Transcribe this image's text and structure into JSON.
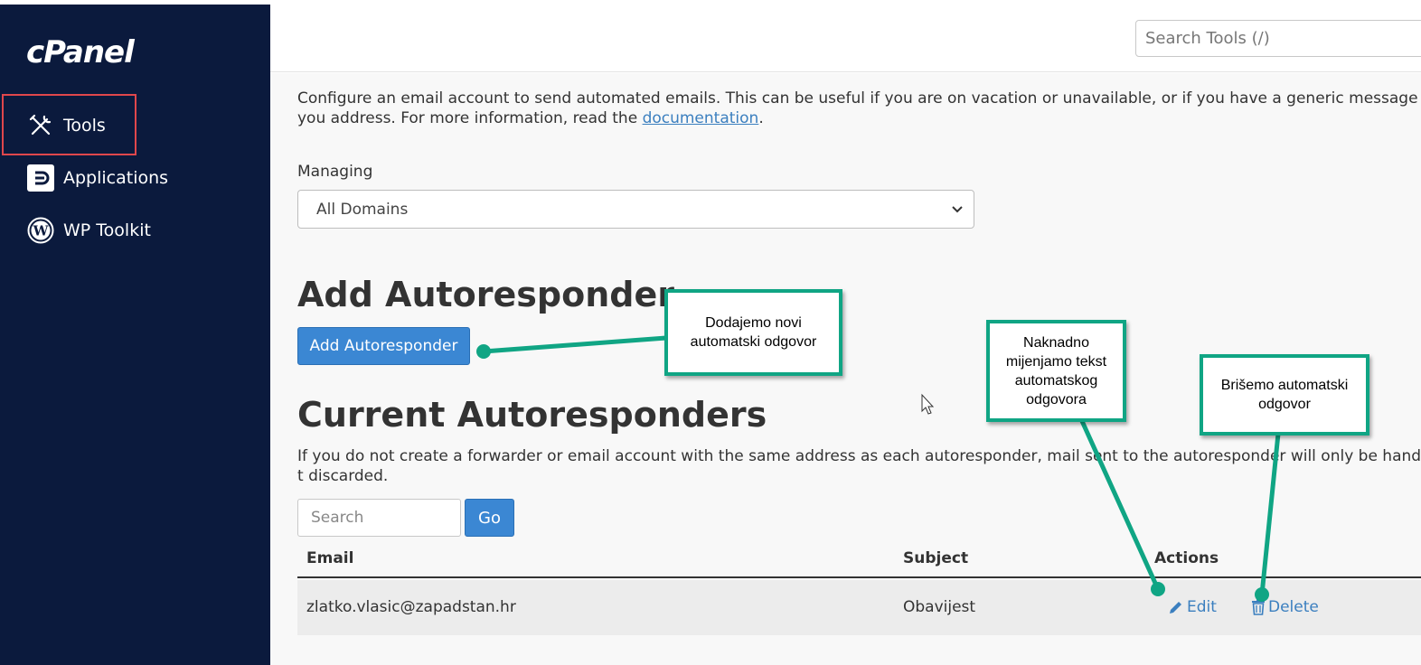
{
  "sidebar": {
    "logo": "cPanel",
    "items": [
      {
        "label": "Tools",
        "icon": "tools-icon"
      },
      {
        "label": "Applications",
        "icon": "applications-icon"
      },
      {
        "label": "WP Toolkit",
        "icon": "wordpress-icon"
      }
    ]
  },
  "header": {
    "search_placeholder": "Search Tools (/)"
  },
  "intro": {
    "text_before": "Configure an email account to send automated emails. This can be useful if you are on vacation or unavailable, or if you have a generic message that you address. For more information, read the ",
    "link": "documentation",
    "text_after": "."
  },
  "managing": {
    "label": "Managing",
    "selected": "All Domains"
  },
  "add_section": {
    "heading": "Add Autoresponder",
    "button": "Add Autoresponder"
  },
  "current_section": {
    "heading": "Current Autoresponders",
    "description": "If you do not create a forwarder or email account with the same address as each autoresponder, mail sent to the autoresponder will only be handled by t discarded.",
    "search_placeholder": "Search",
    "go_button": "Go"
  },
  "table": {
    "columns": [
      "Email",
      "Subject",
      "Actions"
    ],
    "rows": [
      {
        "email": "zlatko.vlasic@zapadstan.hr",
        "subject": "Obavijest",
        "edit": "Edit",
        "delete": "Delete"
      }
    ]
  },
  "callouts": {
    "add": "Dodajemo novi\nautomatski odgovor",
    "edit": "Naknadno\nmijenjamo tekst\nautomatskog\nodgovora",
    "delete": "Brišemo automatski\nodgovor"
  },
  "colors": {
    "sidebar_bg": "#0b1a3d",
    "primary_button": "#3b87d3",
    "link": "#3b7fbf",
    "callout_border": "#10a584",
    "highlight_border": "#e0474c"
  }
}
